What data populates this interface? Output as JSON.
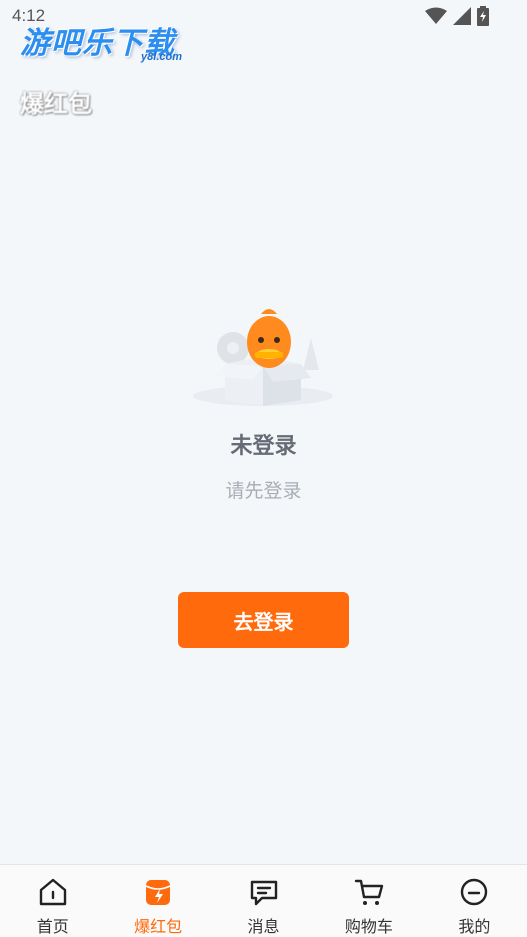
{
  "status_bar": {
    "time": "4:12"
  },
  "watermark": {
    "title": "游吧乐下载",
    "sub": "y8l.com"
  },
  "header": {
    "title": "爆红包"
  },
  "empty_state": {
    "title": "未登录",
    "subtitle": "请先登录"
  },
  "login_button": {
    "label": "去登录"
  },
  "colors": {
    "accent": "#ff6a0c",
    "background": "#f4f7fa"
  },
  "tabs": [
    {
      "label": "首页",
      "icon": "home-icon",
      "active": false
    },
    {
      "label": "爆红包",
      "icon": "red-packet-icon",
      "active": true
    },
    {
      "label": "消息",
      "icon": "message-icon",
      "active": false
    },
    {
      "label": "购物车",
      "icon": "cart-icon",
      "active": false
    },
    {
      "label": "我的",
      "icon": "profile-icon",
      "active": false
    }
  ]
}
